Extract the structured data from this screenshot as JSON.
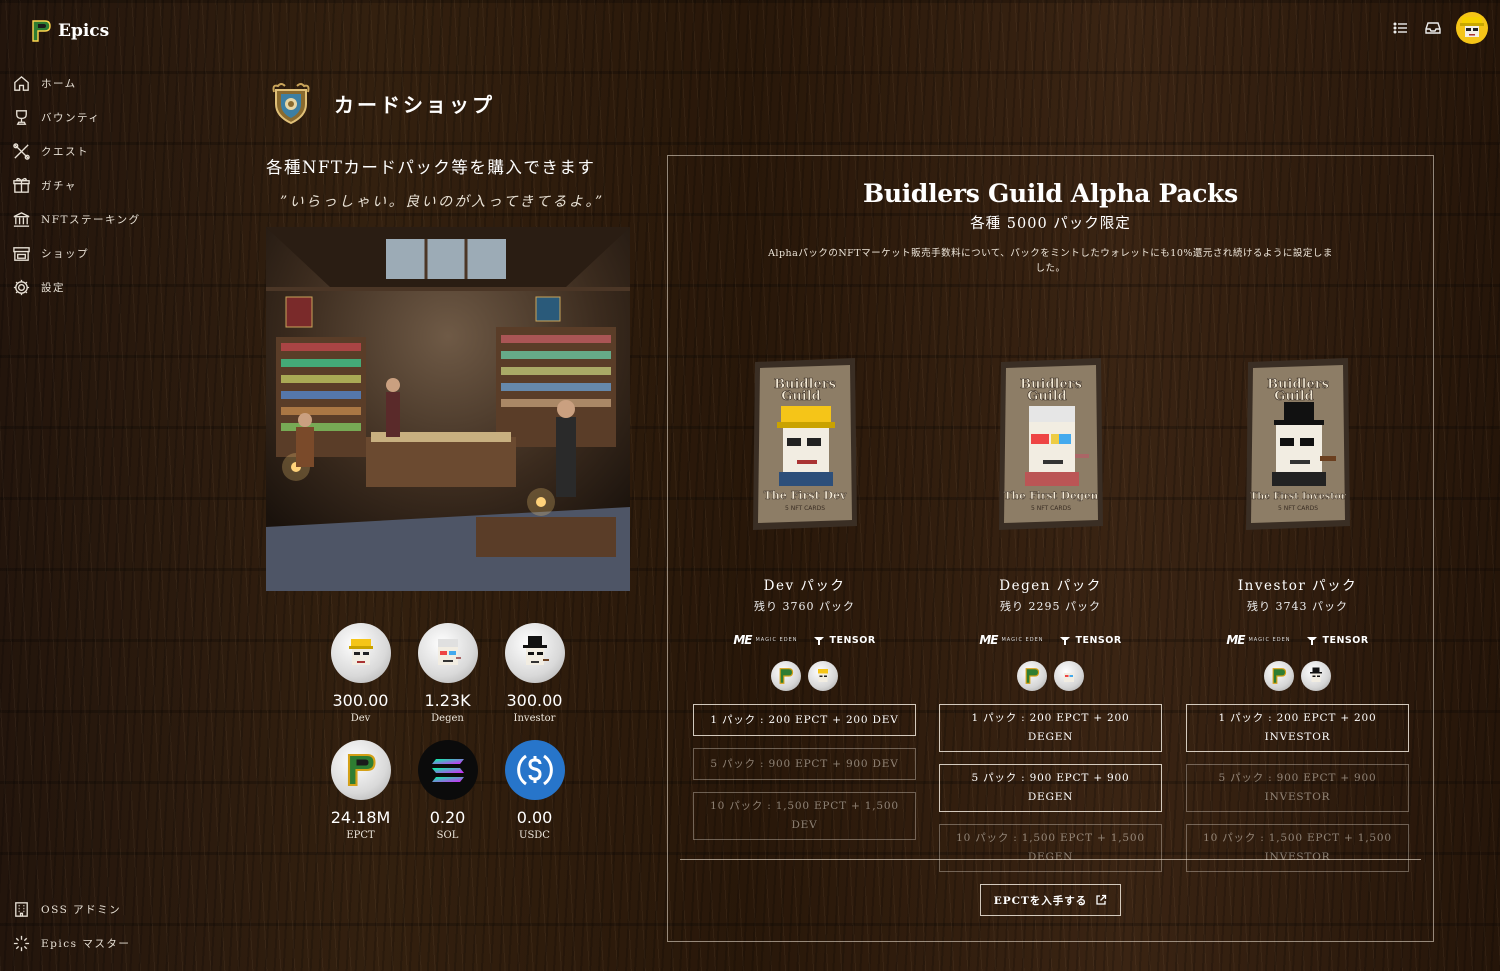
{
  "app": {
    "name": "Epics"
  },
  "sidebar": {
    "items": [
      {
        "label": "ホーム",
        "icon": "home-icon"
      },
      {
        "label": "バウンティ",
        "icon": "trophy-icon"
      },
      {
        "label": "クエスト",
        "icon": "tools-icon"
      },
      {
        "label": "ガチャ",
        "icon": "gift-icon"
      },
      {
        "label": "NFTステーキング",
        "icon": "bank-icon"
      },
      {
        "label": "ショップ",
        "icon": "store-icon"
      },
      {
        "label": "設定",
        "icon": "gear-icon"
      }
    ],
    "bottom_items": [
      {
        "label": "OSS アドミン",
        "icon": "building-icon"
      },
      {
        "label": "Epics マスター",
        "icon": "sparkle-icon"
      }
    ]
  },
  "page": {
    "title": "カードショップ",
    "subtitle": "各種NFTカードパック等を購入できます",
    "quote": "”いらっしゃい。良いのが入ってきてるよ。”"
  },
  "balances": [
    {
      "value": "300.00",
      "label": "Dev",
      "icon": "dev-token-icon"
    },
    {
      "value": "1.23K",
      "label": "Degen",
      "icon": "degen-token-icon"
    },
    {
      "value": "300.00",
      "label": "Investor",
      "icon": "investor-token-icon"
    },
    {
      "value": "24.18M",
      "label": "EPCT",
      "icon": "epct-token-icon"
    },
    {
      "value": "0.20",
      "label": "SOL",
      "icon": "sol-token-icon"
    },
    {
      "value": "0.00",
      "label": "USDC",
      "icon": "usdc-token-icon"
    }
  ],
  "panel": {
    "title": "Buidlers Guild Alpha Packs",
    "subtitle": "各種 5000 パック限定",
    "note": "AlphaパックのNFTマーケット販売手数料について、パックをミントしたウォレットにも10%還元され続けるように設定しました。",
    "get_epct_label": "EPCTを入手する"
  },
  "packs": [
    {
      "pack_title_1": "Buidlers",
      "pack_title_2": "Guild",
      "pack_caption": "The First Dev",
      "pack_sub": "5 NFT CARDS",
      "name": "Dev パック",
      "remaining": "残り 3760 パック",
      "market_me": "MAGIC EDEN",
      "market_tensor": "TENSOR",
      "buttons": [
        {
          "label": "1 パック : 200 EPCT + 200 DEV",
          "enabled": true
        },
        {
          "label": "5 パック : 900 EPCT + 900 DEV",
          "enabled": false
        },
        {
          "label": "10 パック : 1,500 EPCT + 1,500 DEV",
          "enabled": false
        }
      ]
    },
    {
      "pack_title_1": "Buidlers",
      "pack_title_2": "Guild",
      "pack_caption": "The First Degen",
      "pack_sub": "5 NFT CARDS",
      "name": "Degen パック",
      "remaining": "残り 2295 パック",
      "market_me": "MAGIC EDEN",
      "market_tensor": "TENSOR",
      "buttons": [
        {
          "label": "1 パック : 200 EPCT + 200 DEGEN",
          "enabled": true
        },
        {
          "label": "5 パック : 900 EPCT + 900 DEGEN",
          "enabled": true
        },
        {
          "label": "10 パック : 1,500 EPCT + 1,500 DEGEN",
          "enabled": false
        }
      ]
    },
    {
      "pack_title_1": "Buidlers",
      "pack_title_2": "Guild",
      "pack_caption": "The First Investor",
      "pack_sub": "5 NFT CARDS",
      "name": "Investor パック",
      "remaining": "残り 3743 パック",
      "market_me": "MAGIC EDEN",
      "market_tensor": "TENSOR",
      "buttons": [
        {
          "label": "1 パック : 200 EPCT + 200 INVESTOR",
          "enabled": true
        },
        {
          "label": "5 パック : 900 EPCT + 900 INVESTOR",
          "enabled": false
        },
        {
          "label": "10 パック : 1,500 EPCT + 1,500 INVESTOR",
          "enabled": false
        }
      ]
    }
  ],
  "colors": {
    "accent": "#f5c518",
    "background": "#2a1a10",
    "usdc": "#2775ca",
    "text": "#f1ece4"
  }
}
